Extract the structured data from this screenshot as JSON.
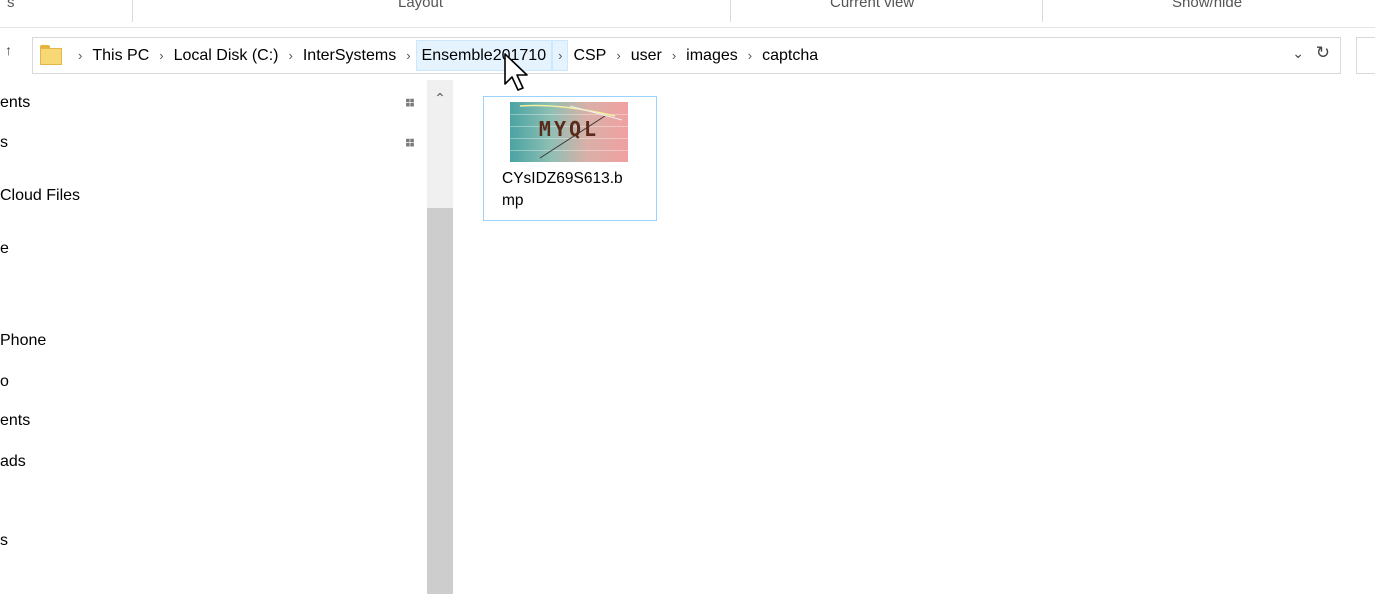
{
  "ribbon": {
    "groups": [
      "s",
      "Layout",
      "Current view",
      "Show/hide"
    ]
  },
  "address_bar": {
    "up_arrow": "up-arrow",
    "crumbs": [
      "This PC",
      "Local Disk (C:)",
      "InterSystems",
      "Ensemble201710",
      "CSP",
      "user",
      "images",
      "captcha"
    ],
    "separator": "›",
    "dropdown_glyph": "⌄",
    "refresh_glyph": "↻"
  },
  "nav_pane": {
    "items": [
      "ents",
      "s",
      "Cloud Files",
      "e",
      "Phone",
      "o",
      "ents",
      "ads",
      "s"
    ],
    "pin_glyph": "📌",
    "scroll_up_glyph": "⌃"
  },
  "files": [
    {
      "name": "CYsIDZ69S613.bmp",
      "name_line1": "CYsIDZ69S613.b",
      "name_line2": "mp",
      "thumb_text": "MYQL"
    }
  ]
}
